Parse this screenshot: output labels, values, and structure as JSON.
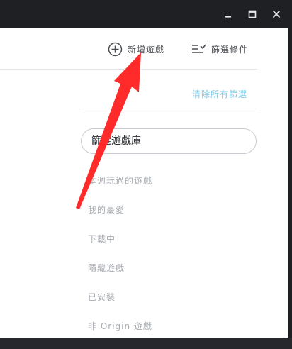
{
  "toolbar": {
    "add_game_label": "新增遊戲",
    "filter_label": "篩選條件"
  },
  "filters": {
    "clear_all": "清除所有篩選",
    "search_placeholder": "篩選遊戲庫",
    "items": [
      "本週玩過的遊戲",
      "我的最愛",
      "下載中",
      "隱藏遊戲",
      "已安裝",
      "非 Origin 遊戲"
    ]
  },
  "colors": {
    "accent_link": "#7fc9e8",
    "annotation_arrow": "#ff2a2a",
    "titlebar": "#1e2024"
  },
  "icons": {
    "add": "plus-circle-icon",
    "filter": "filter-list-icon",
    "minimize": "minimize-icon",
    "maximize": "maximize-icon",
    "close": "close-icon"
  }
}
